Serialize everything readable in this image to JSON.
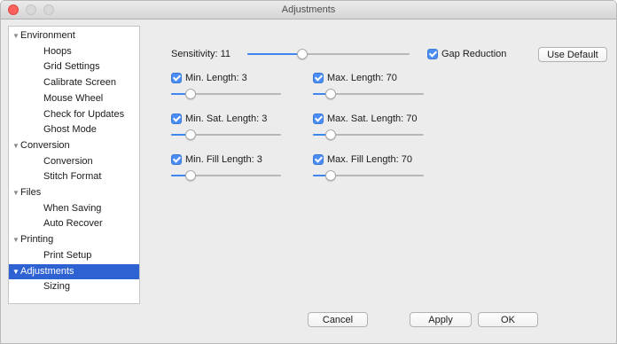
{
  "window": {
    "title": "Adjustments"
  },
  "sidebar": {
    "items": [
      {
        "label": "Environment",
        "kind": "group"
      },
      {
        "label": "Hoops",
        "kind": "child"
      },
      {
        "label": "Grid Settings",
        "kind": "child"
      },
      {
        "label": "Calibrate Screen",
        "kind": "child"
      },
      {
        "label": "Mouse Wheel",
        "kind": "child"
      },
      {
        "label": "Check for Updates",
        "kind": "child"
      },
      {
        "label": "Ghost Mode",
        "kind": "child"
      },
      {
        "label": "Conversion",
        "kind": "group"
      },
      {
        "label": "Conversion",
        "kind": "child"
      },
      {
        "label": "Stitch Format",
        "kind": "child"
      },
      {
        "label": "Files",
        "kind": "group"
      },
      {
        "label": "When Saving",
        "kind": "child"
      },
      {
        "label": "Auto Recover",
        "kind": "child"
      },
      {
        "label": "Printing",
        "kind": "group"
      },
      {
        "label": "Print Setup",
        "kind": "child"
      },
      {
        "label": "Adjustments",
        "kind": "group",
        "selected": true
      },
      {
        "label": "Sizing",
        "kind": "child"
      }
    ]
  },
  "settings": {
    "sensitivity": {
      "label": "Sensitivity: 11",
      "level": 0.34
    },
    "gap_reduction": {
      "label": "Gap Reduction",
      "checked": true
    },
    "use_default": "Use Default",
    "min_length": {
      "label": "Min. Length: 3",
      "checked": true,
      "level": 0.18
    },
    "max_length": {
      "label": "Max. Length: 70",
      "checked": true,
      "level": 0.16
    },
    "min_sat_length": {
      "label": "Min. Sat. Length: 3",
      "checked": true,
      "level": 0.18
    },
    "max_sat_length": {
      "label": "Max. Sat. Length: 70",
      "checked": true,
      "level": 0.16
    },
    "min_fill_length": {
      "label": "Min. Fill Length: 3",
      "checked": true,
      "level": 0.18
    },
    "max_fill_length": {
      "label": "Max. Fill Length: 70",
      "checked": true,
      "level": 0.16
    }
  },
  "footer": {
    "cancel": "Cancel",
    "apply": "Apply",
    "ok": "OK"
  },
  "colors": {
    "accent": "#3f86f0",
    "selection": "#2e62d2",
    "close": "#fc605b"
  },
  "icons": [
    "disclosure-triangle-icon",
    "checkmark-icon"
  ]
}
